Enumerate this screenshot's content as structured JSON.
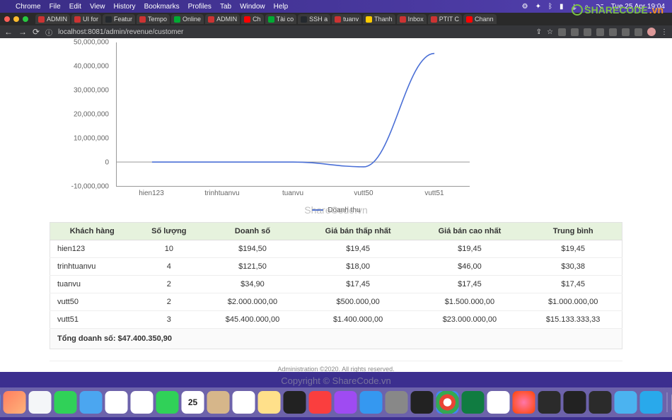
{
  "menubar": {
    "app": "Chrome",
    "items": [
      "File",
      "Edit",
      "View",
      "History",
      "Bookmarks",
      "Profiles",
      "Tab",
      "Window",
      "Help"
    ],
    "clock": "Tue 25 Apr 19:04"
  },
  "tabs": [
    "ADMIN",
    "UI for",
    "Featur",
    "Tempo",
    "Online",
    "ADMIN",
    "Ch",
    "Tài co",
    "SSH a",
    "tuanv",
    "Thanh",
    "Inbox",
    "PTIT C",
    "Chann"
  ],
  "url": "localhost:8081/admin/revenue/customer",
  "chart_data": {
    "type": "line",
    "title": "",
    "xlabel": "",
    "ylabel": "",
    "ylim": [
      -10000000,
      50000000
    ],
    "y_ticks": [
      "50,000,000",
      "40,000,000",
      "30,000,000",
      "20,000,000",
      "10,000,000",
      "0",
      "-10,000,000"
    ],
    "categories": [
      "hien123",
      "trinhtuanvu",
      "tuanvu",
      "vutt50",
      "vutt51"
    ],
    "series": [
      {
        "name": "Doanh thu",
        "values": [
          0,
          0,
          0,
          -2000000,
          45400000
        ]
      }
    ],
    "legend_label": "Doanh thu"
  },
  "table": {
    "headers": [
      "Khách hàng",
      "Số lượng",
      "Doanh số",
      "Giá bán thấp nhất",
      "Giá bán cao nhất",
      "Trung bình"
    ],
    "rows": [
      [
        "hien123",
        "10",
        "$194,50",
        "$19,45",
        "$19,45",
        "$19,45"
      ],
      [
        "trinhtuanvu",
        "4",
        "$121,50",
        "$18,00",
        "$46,00",
        "$30,38"
      ],
      [
        "tuanvu",
        "2",
        "$34,90",
        "$17,45",
        "$17,45",
        "$17,45"
      ],
      [
        "vutt50",
        "2",
        "$2.000.000,00",
        "$500.000,00",
        "$1.500.000,00",
        "$1.000.000,00"
      ],
      [
        "vutt51",
        "3",
        "$45.400.000,00",
        "$1.400.000,00",
        "$23.000.000,00",
        "$15.133.333,33"
      ]
    ],
    "footer": "Tổng doanh số: $47.400.350,90"
  },
  "footer_text": "Administration ©2020. All rights reserved.",
  "watermark": {
    "center": "ShareCode.vn",
    "bottom": "Copyright © ShareCode.vn",
    "logo": "SHARECODE",
    "logo_vn": ".vn"
  }
}
